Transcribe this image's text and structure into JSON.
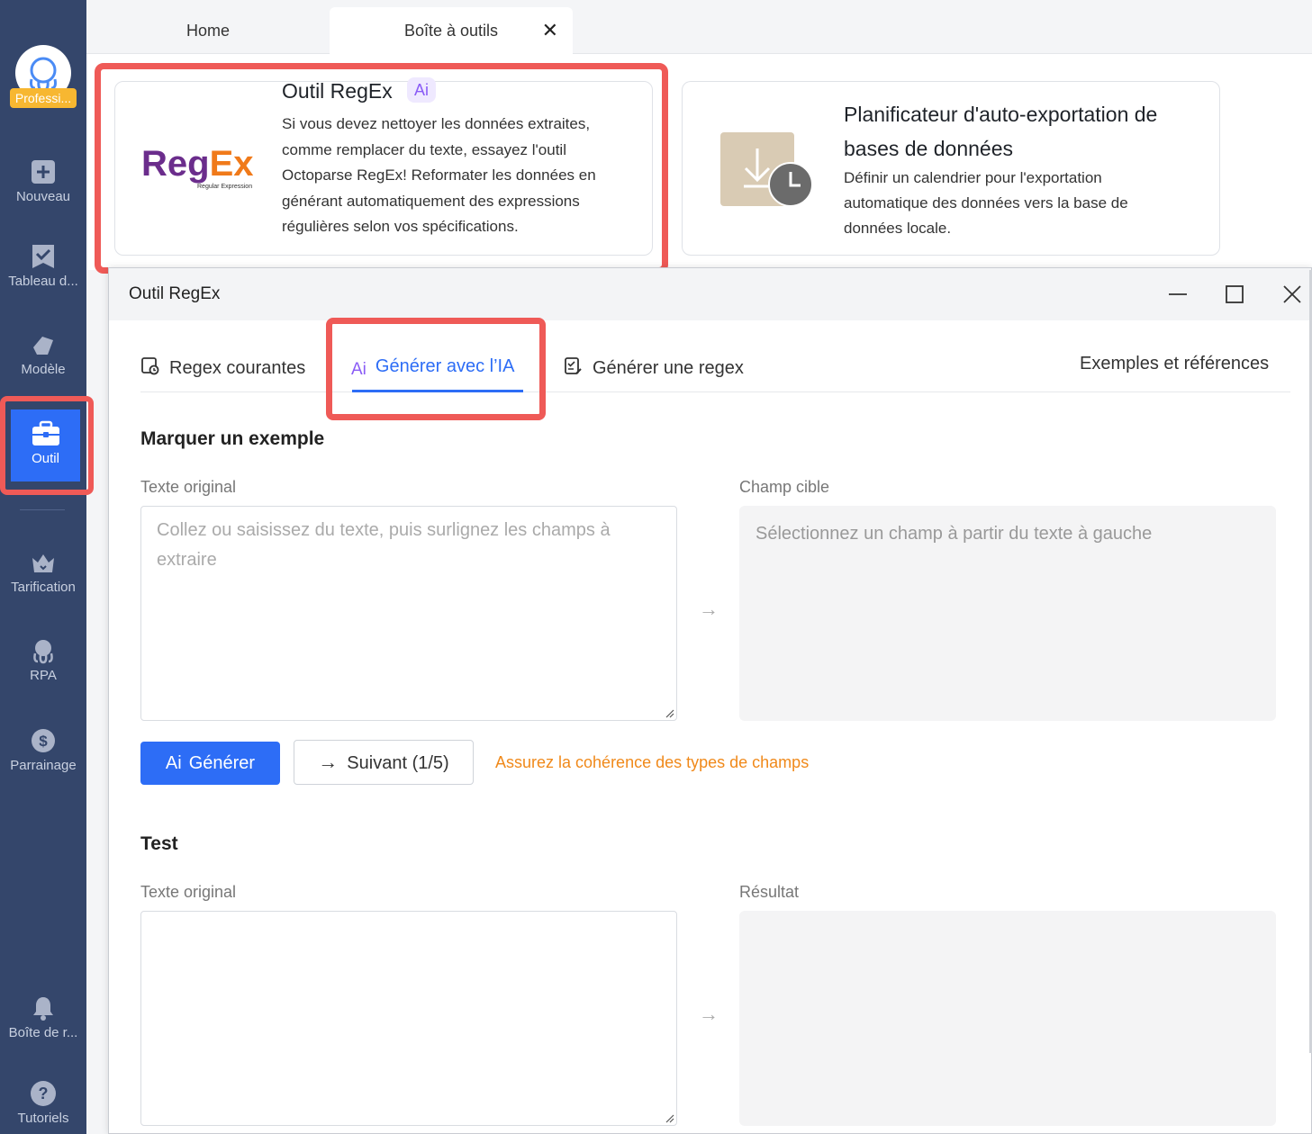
{
  "sidebar": {
    "avatar_badge": "Professi...",
    "items": [
      {
        "label": "Nouveau",
        "icon": "plus-square-icon"
      },
      {
        "label": "Tableau d...",
        "icon": "dashboard-check-icon"
      },
      {
        "label": "Modèle",
        "icon": "template-icon"
      },
      {
        "label": "Outil",
        "icon": "toolbox-icon"
      },
      {
        "label": "Tarification",
        "icon": "crown-icon"
      },
      {
        "label": "RPA",
        "icon": "rpa-octopus-icon"
      },
      {
        "label": "Parrainage",
        "icon": "dollar-icon"
      },
      {
        "label": "Boîte de r...",
        "icon": "bell-icon"
      },
      {
        "label": "Tutoriels",
        "icon": "help-icon"
      }
    ]
  },
  "tabs": {
    "home": "Home",
    "active": "Boîte à outils",
    "close": "✕"
  },
  "cards": {
    "regex": {
      "title": "Outil RegEx",
      "ai_badge": "Ai",
      "description": "Si vous devez nettoyer les données extraites, comme remplacer du texte, essayez l'outil Octoparse RegEx! Reformater les données en générant automatiquement des expressions régulières selon vos spécifications.",
      "logo_text_a": "Reg",
      "logo_text_b": "Ex",
      "logo_sub": "Regular Expression"
    },
    "scheduler": {
      "title": "Planificateur d'auto-exportation de bases de données",
      "description": "Définir un calendrier pour l'exportation automatique des données vers la base de données locale."
    }
  },
  "dialog": {
    "title": "Outil RegEx",
    "tabs": {
      "common": "Regex courantes",
      "ai": "Générer avec l’IA",
      "generate": "Générer une regex",
      "examples": "Exemples et références"
    },
    "mark": {
      "section": "Marquer un exemple",
      "original_label": "Texte original",
      "original_placeholder": "Collez ou saisissez du texte, puis surlignez les champs à extraire",
      "target_label": "Champ cible",
      "target_placeholder": "Sélectionnez un champ à partir du texte à gauche",
      "arrow": "→"
    },
    "buttons": {
      "generate": "Générer",
      "next": "Suivant (1/5)",
      "warning": "Assurez la cohérence des types de champs"
    },
    "test": {
      "section": "Test",
      "original_label": "Texte original",
      "result_label": "Résultat",
      "arrow": "→"
    }
  },
  "colors": {
    "sidebar_bg": "#34466b",
    "accent": "#2d6df6",
    "highlight": "#ef5a57",
    "warning": "#f0891a"
  }
}
